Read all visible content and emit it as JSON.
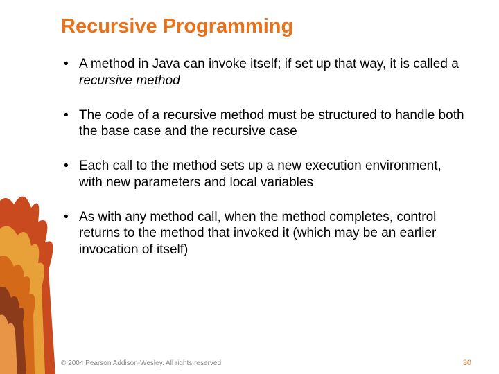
{
  "title": "Recursive Programming",
  "bullets": [
    {
      "pre": "A method in Java can invoke itself;  if set up that way, it is called a ",
      "em": "recursive method",
      "post": ""
    },
    {
      "pre": "The code of a recursive method must be structured to handle both the base case and the recursive case",
      "em": "",
      "post": ""
    },
    {
      "pre": "Each call to the method sets up a new execution environment, with new parameters and local variables",
      "em": "",
      "post": ""
    },
    {
      "pre": "As with any method call, when the method completes, control returns to the method that invoked it (which may be an earlier invocation of itself)",
      "em": "",
      "post": ""
    }
  ],
  "footer": {
    "copyright": "© 2004 Pearson Addison-Wesley. All rights reserved",
    "page": "30"
  }
}
